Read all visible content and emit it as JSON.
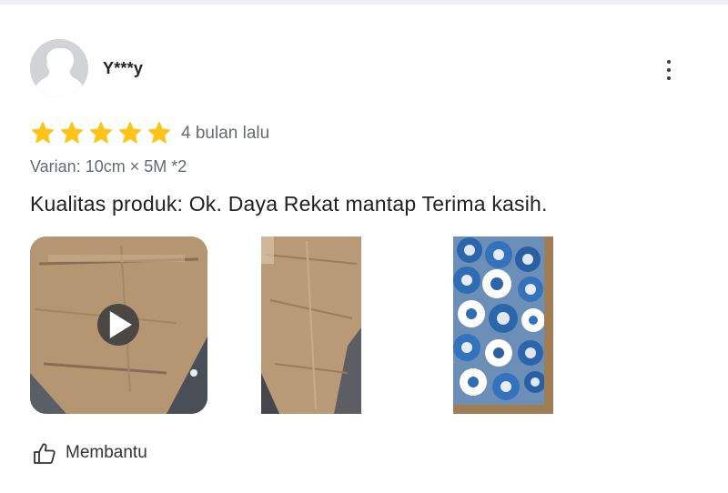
{
  "review": {
    "username": "Y***y",
    "rating": 5,
    "rating_max": 5,
    "time_ago": "4 bulan lalu",
    "variant": "Varian: 10cm × 5M  *2",
    "text": "Kualitas produk: Ok. Daya Rekat mantap Terima kasih.",
    "media": [
      {
        "type": "video",
        "icon": "play-icon"
      },
      {
        "type": "photo"
      },
      {
        "type": "photo"
      }
    ],
    "helpful_label": "Membantu"
  },
  "icons": {
    "avatar": "avatar-placeholder-icon",
    "more": "more-vertical-icon",
    "star": "star-icon",
    "helpful": "thumbs-up-icon"
  },
  "colors": {
    "star": "#ffc21a",
    "muted_text": "#666a73",
    "top_strip": "#eef0f6",
    "avatar_bg": "#d2d3d7"
  }
}
